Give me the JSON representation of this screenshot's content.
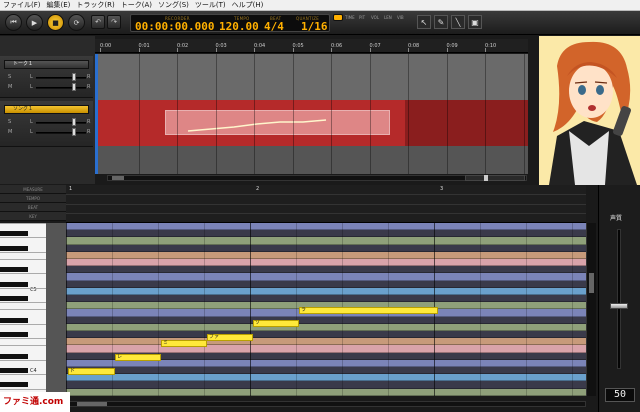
{
  "menu": [
    "ファイル(F)",
    "編集(E)",
    "トラック(R)",
    "トーク(A)",
    "ソング(S)",
    "ツール(T)",
    "ヘルプ(H)"
  ],
  "transport": {
    "recorder_label": "RECORDER",
    "recorder_time": "00:00:00.000",
    "tempo_label": "TEMPO",
    "tempo": "120.00",
    "beat_label": "BEAT",
    "beat": "4/4",
    "quantize_label": "QUANTIZE",
    "quantize": "1/16"
  },
  "modes": [
    "TIME",
    "PIT",
    "VOL",
    "LEN",
    "VIB"
  ],
  "tracks": [
    {
      "name": "トーク１",
      "s": "S",
      "m": "M",
      "l": "L",
      "r": "R"
    },
    {
      "name": "ソング１",
      "s": "S",
      "m": "M",
      "l": "L",
      "r": "R"
    }
  ],
  "ruler_ticks": [
    "0:00",
    "0:01",
    "0:02",
    "0:03",
    "0:04",
    "0:05",
    "0:06",
    "0:07",
    "0:08",
    "0:09",
    "0:10"
  ],
  "pr_headers": [
    "MEASURE",
    "TEMPO",
    "BEAT",
    "KEY"
  ],
  "measures": [
    "1",
    "2",
    "3"
  ],
  "key_labels": {
    "c5": "C5",
    "c4": "C4"
  },
  "notes": [
    {
      "lyric": "ド"
    },
    {
      "lyric": "レ"
    },
    {
      "lyric": "ミ"
    },
    {
      "lyric": "ファ"
    },
    {
      "lyric": "ソ"
    },
    {
      "lyric": "ラ"
    }
  ],
  "volume": {
    "title": "声質",
    "value": "50"
  },
  "watermark": "ファミ通.com",
  "colors": {
    "accent": "#ffb000",
    "note": "#ffe93a",
    "song_track": "#b52a2a"
  }
}
